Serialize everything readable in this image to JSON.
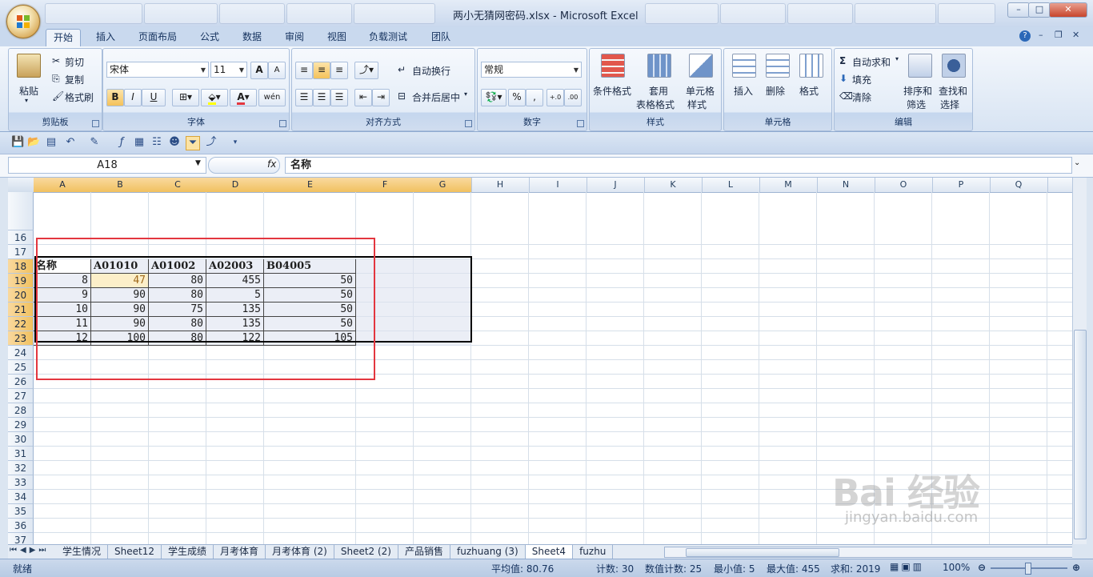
{
  "window": {
    "title": "两小无猜网密码.xlsx - Microsoft Excel",
    "minimize": "–",
    "maximize": "□",
    "close": "✕"
  },
  "ribbon_tabs": [
    "开始",
    "插入",
    "页面布局",
    "公式",
    "数据",
    "审阅",
    "视图",
    "负载测试",
    "团队"
  ],
  "ribbon": {
    "clipboard": {
      "label": "剪贴板",
      "paste": "粘贴",
      "cut": "剪切",
      "copy": "复制",
      "format_painter": "格式刷"
    },
    "font": {
      "label": "字体",
      "font_name": "宋体",
      "font_size": "11",
      "bold": "B",
      "italic": "I",
      "underline": "U",
      "grow": "A",
      "shrink": "A",
      "phonetic": "wén"
    },
    "alignment": {
      "label": "对齐方式",
      "wrap": "自动换行",
      "merge": "合并后居中"
    },
    "number": {
      "label": "数字",
      "format": "常规",
      "percent": "%",
      "comma": ","
    },
    "styles": {
      "label": "样式",
      "conditional": "条件格式",
      "table_line1": "套用",
      "table_line2": "表格格式",
      "cell_line1": "单元格",
      "cell_line2": "样式"
    },
    "cells": {
      "label": "单元格",
      "insert": "插入",
      "delete": "删除",
      "format": "格式"
    },
    "editing": {
      "label": "编辑",
      "autosum": "自动求和",
      "fill": "填充",
      "clear": "清除",
      "sort_line1": "排序和",
      "sort_line2": "筛选",
      "find_line1": "查找和",
      "find_line2": "选择"
    }
  },
  "formula_bar": {
    "name_box": "A18",
    "fx": "fx",
    "formula": "名称"
  },
  "columns": [
    "A",
    "B",
    "C",
    "D",
    "E",
    "F",
    "G",
    "H",
    "I",
    "J",
    "K",
    "L",
    "M",
    "N",
    "O",
    "P",
    "Q"
  ],
  "rows": [
    "16",
    "17",
    "18",
    "19",
    "20",
    "21",
    "22",
    "23",
    "24",
    "25",
    "26",
    "27",
    "28",
    "29",
    "30",
    "31",
    "32",
    "33",
    "34",
    "35",
    "36",
    "37"
  ],
  "table": {
    "headers": [
      "名称",
      "A01010",
      "A01002",
      "A02003",
      "B04005"
    ],
    "data": [
      [
        "8",
        "47",
        "80",
        "455",
        "50"
      ],
      [
        "9",
        "90",
        "80",
        "5",
        "50"
      ],
      [
        "10",
        "90",
        "75",
        "135",
        "50"
      ],
      [
        "11",
        "90",
        "80",
        "135",
        "50"
      ],
      [
        "12",
        "100",
        "80",
        "122",
        "105"
      ]
    ]
  },
  "sheet_tabs": [
    "学生情况",
    "Sheet12",
    "学生成绩",
    "月考体育",
    "月考体育 (2)",
    "Sheet2 (2)",
    "产品销售",
    "fuzhuang (3)",
    "Sheet4",
    "fuzhu"
  ],
  "active_sheet": "Sheet4",
  "status": {
    "ready": "就绪",
    "average": "平均值: 80.76",
    "count": "计数: 30",
    "numeric_count": "数值计数: 25",
    "min": "最小值: 5",
    "max": "最大值: 455",
    "sum": "求和: 2019",
    "zoom": "100%"
  },
  "watermark": {
    "brand": "Bai  经验",
    "url": "jingyan.baidu.com"
  },
  "colors": {
    "accent": "#e3363f",
    "ribbon": "#c9d9ee",
    "selection_header": "#f1c15f"
  }
}
